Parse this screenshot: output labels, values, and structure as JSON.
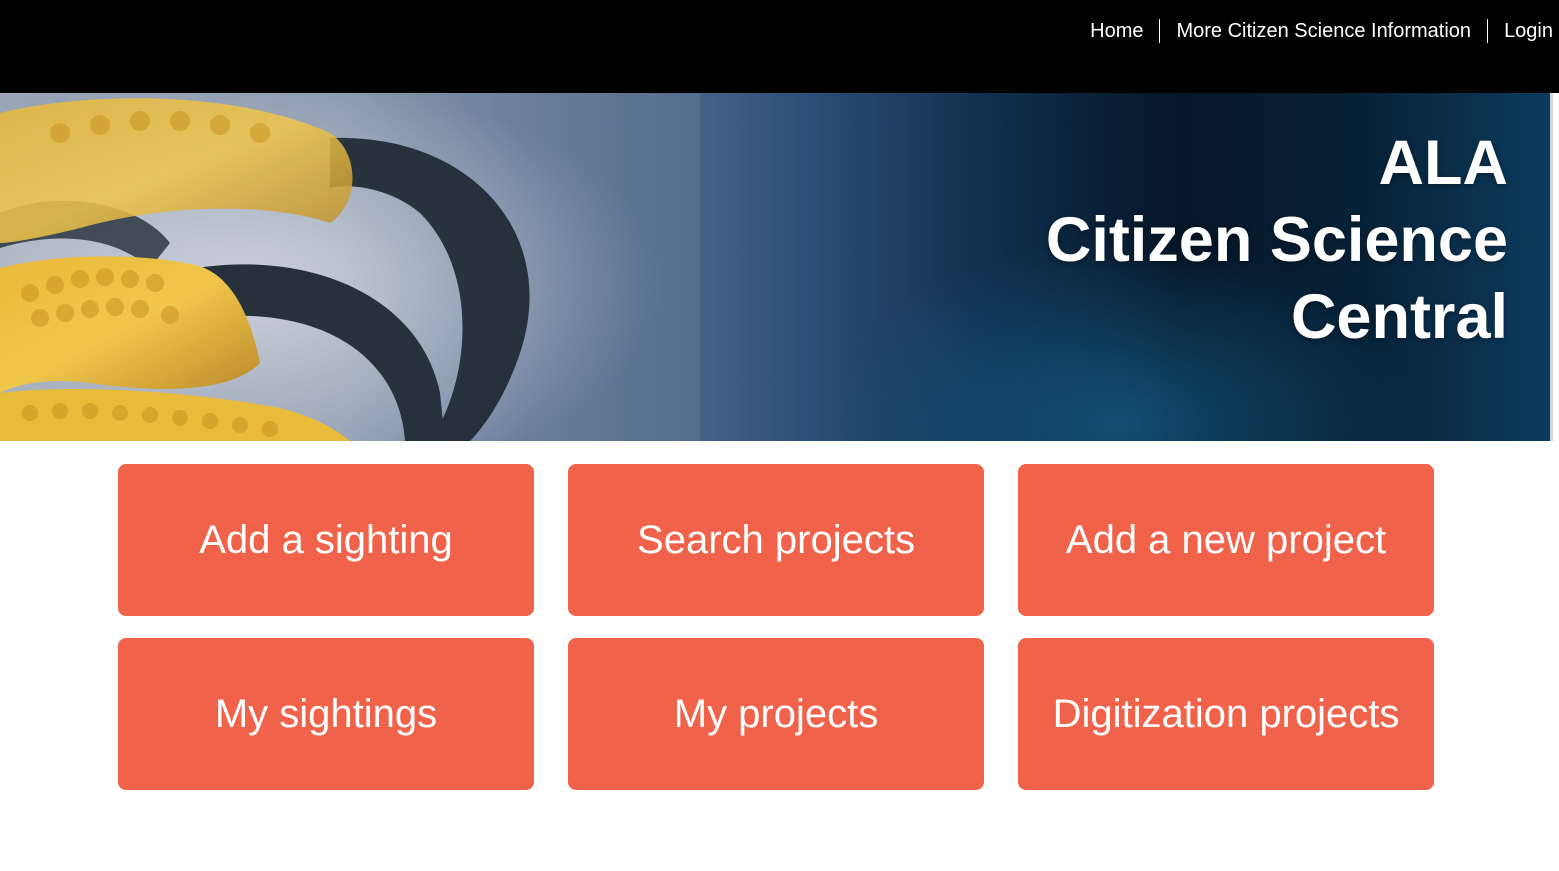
{
  "nav": {
    "home": "Home",
    "more_info": "More Citizen Science Information",
    "login": "Login"
  },
  "hero": {
    "title_line1": "ALA",
    "title_line2": "Citizen Science",
    "title_line3": "Central"
  },
  "tiles": [
    {
      "label": "Add a sighting"
    },
    {
      "label": "Search projects"
    },
    {
      "label": "Add a new project"
    },
    {
      "label": "My sightings"
    },
    {
      "label": "My projects"
    },
    {
      "label": "Digitization projects"
    }
  ],
  "colors": {
    "topbar": "#000000",
    "tile": "#f0634a",
    "tile_text": "#ffffff"
  }
}
